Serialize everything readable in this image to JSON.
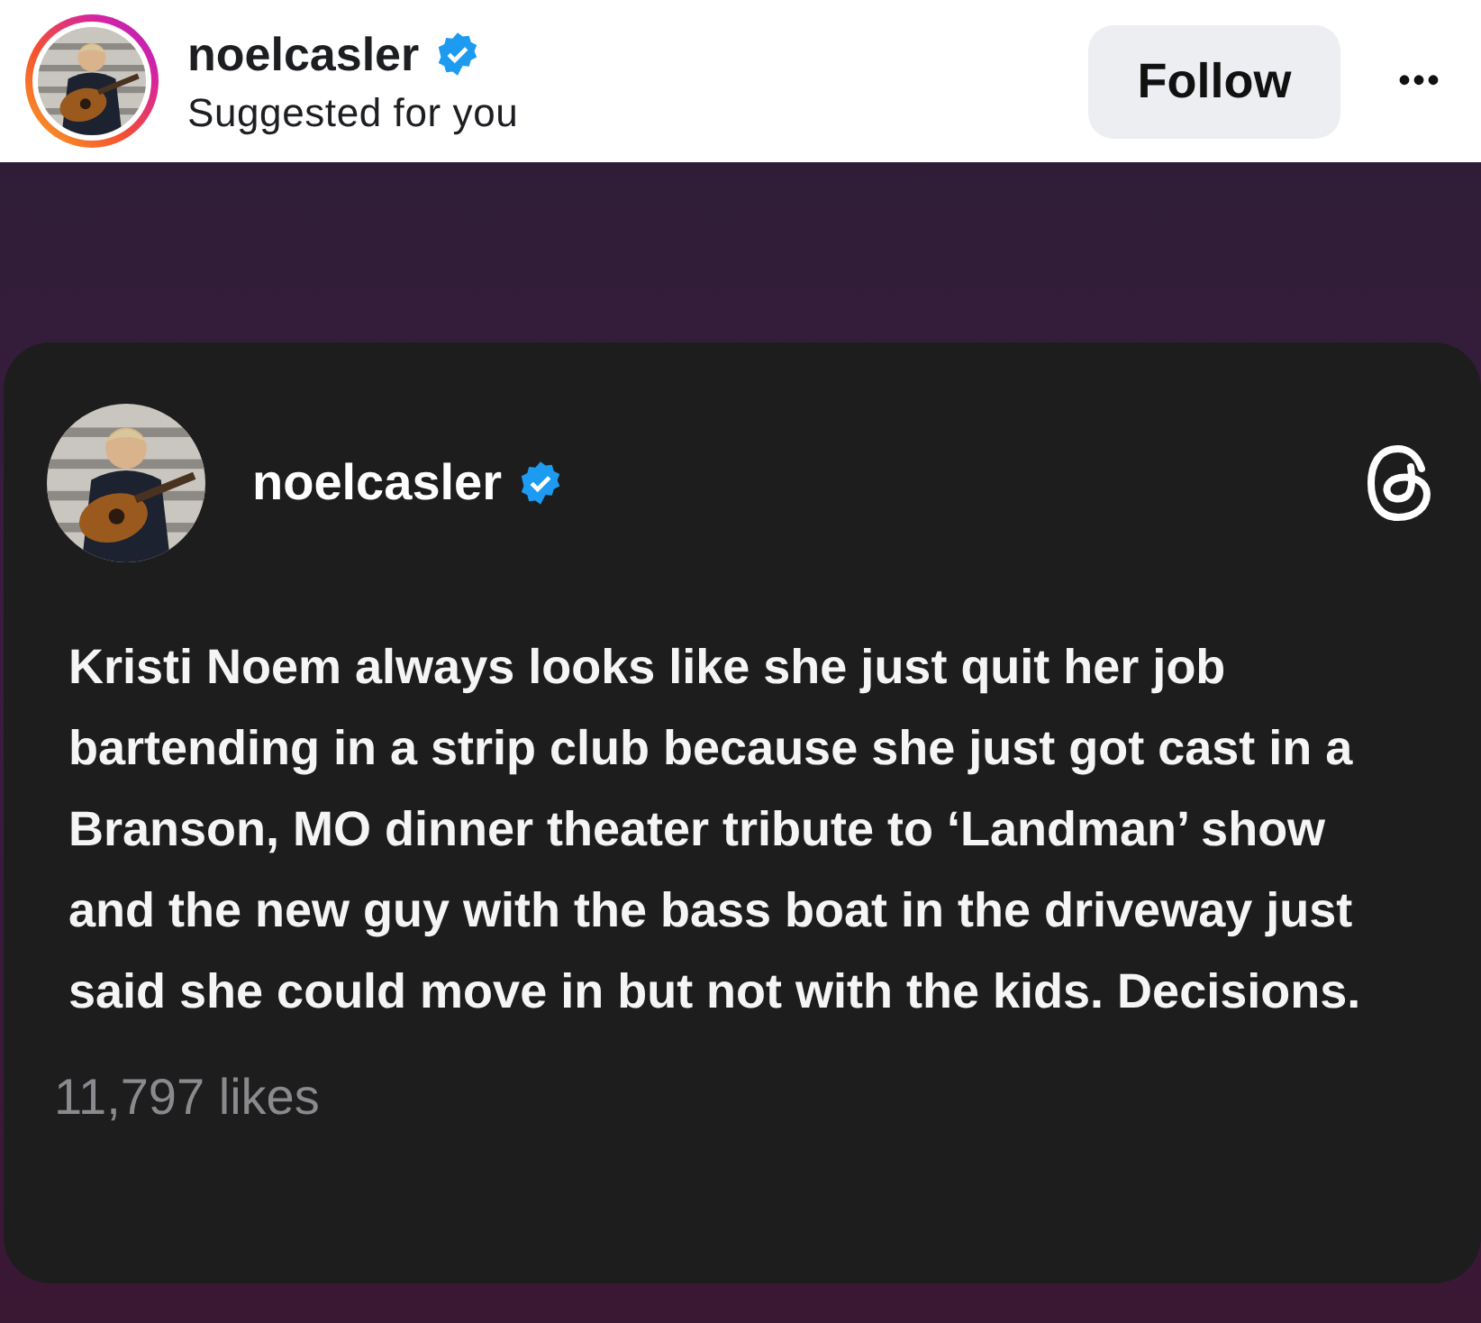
{
  "header": {
    "username": "noelcasler",
    "verified": true,
    "subtitle": "Suggested for you",
    "follow_button": "Follow",
    "menu": "•••"
  },
  "post": {
    "username": "noelcasler",
    "verified": true,
    "text": "Kristi Noem always looks like she just quit her job bartending in a strip club because she just got cast in a Branson, MO dinner theater tribute to ‘Landman’ show and the new guy with the bass boat in the driveway just said she could move in but not with the kids. Decisions.",
    "likes": "11,797 likes"
  }
}
